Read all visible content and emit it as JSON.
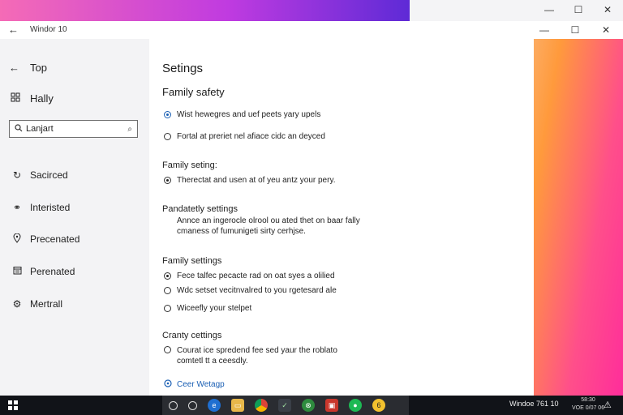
{
  "window": {
    "title": "Windor 10"
  },
  "colors": {
    "accent": "#1a5fb4",
    "sidebar": "#f3f3f5",
    "taskbar": "#111318"
  },
  "sidebar": {
    "back_label": "Top",
    "home_label": "Hally",
    "search_value": "Lanjart",
    "items": [
      {
        "label": "Sacirced",
        "icon": "refresh-icon"
      },
      {
        "label": "Interisted",
        "icon": "link-icon"
      },
      {
        "label": "Precenated",
        "icon": "location-icon"
      },
      {
        "label": "Perenated",
        "icon": "calendar-icon"
      },
      {
        "label": "Mertrall",
        "icon": "gear-icon"
      }
    ]
  },
  "content": {
    "page_title": "Setings",
    "family_safety": {
      "heading": "Family safety",
      "options": [
        {
          "label": "Wist hewegres and uef peets yary upels",
          "selected": true
        },
        {
          "label": "Fortal at preriet nel afiace cidc an deyced",
          "selected": false
        }
      ]
    },
    "family_setting": {
      "heading": "Family seting:",
      "options": [
        {
          "label": "Therectat and usen at of yeu antz your pery.",
          "selected": true
        }
      ]
    },
    "pandatetly": {
      "heading": "Pandatetly settings",
      "desc_line1": "Annce an ingerocle olrool ou ated thet on baar fally",
      "desc_line2": "cmaness of fumunigeti sirty cerhjse."
    },
    "family_settings": {
      "heading": "Family settings",
      "options": [
        {
          "label": "Fece talfec pecacte rad on oat syes a olilied",
          "selected": true
        },
        {
          "label": "Wdc setset vecitnvalred to you rgetesard ale",
          "selected": false
        },
        {
          "label": "Wiceefly your stelpet",
          "selected": false
        }
      ]
    },
    "cranty": {
      "heading": "Cranty cettings",
      "option_line1": "Courat ice spredend fee sed yaur the roblato",
      "option_line2": "comtetl tt a ceesdly."
    },
    "link_label": "Ceer Wetagp"
  },
  "taskbar": {
    "tray_label": "Windoe 761 10",
    "clock_time": "58:30",
    "clock_date": "VOE 0/07 06"
  }
}
